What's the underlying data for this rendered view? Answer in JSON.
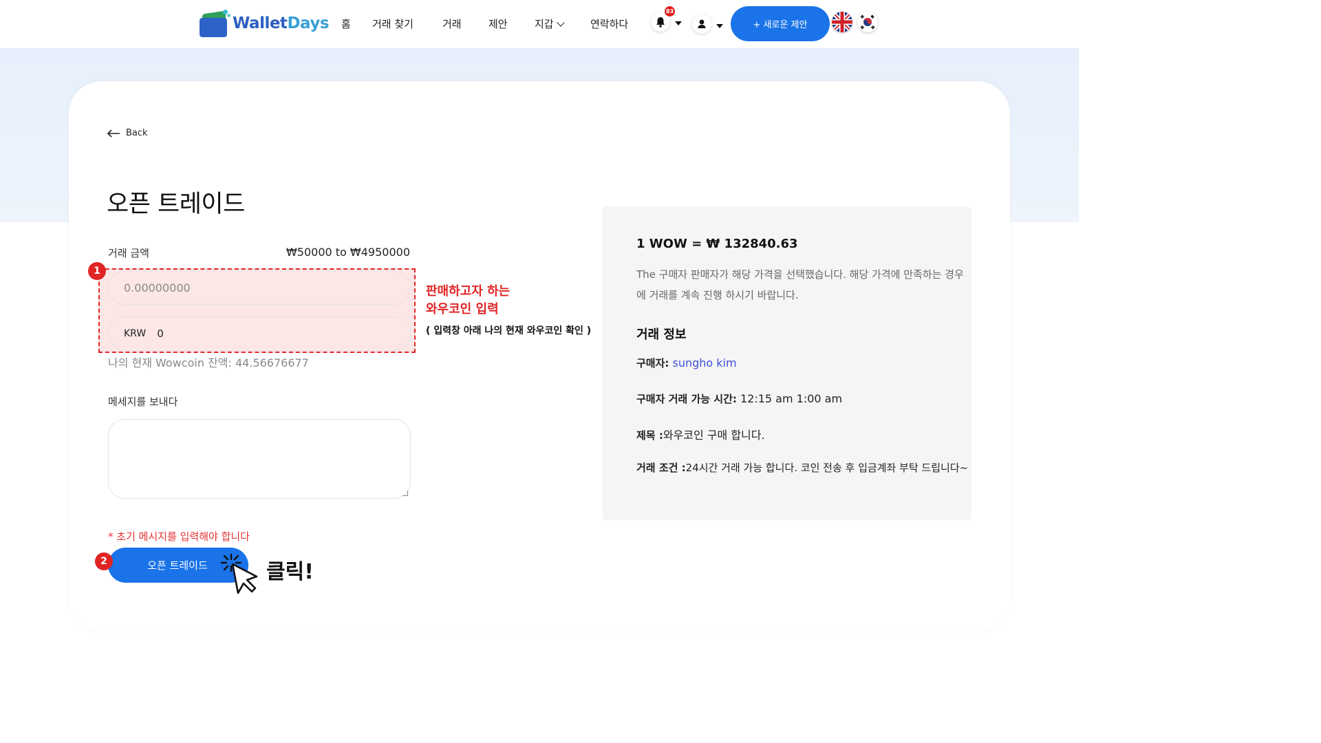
{
  "nav": {
    "logo_part1": "Wallet",
    "logo_part2": "Days",
    "home": "홈",
    "find_trade": "거래 찾기",
    "trade": "거래",
    "offer": "제안",
    "wallet": "지갑",
    "contact": "연락하다",
    "notification_count": "83",
    "new_offer_button": "+ 새로운 제안"
  },
  "page": {
    "back_label": "Back",
    "title": "오픈 트레이드"
  },
  "form": {
    "amount_label": "거래 금액",
    "amount_range": "₩50000 to ₩4950000",
    "wow_placeholder": "0.00000000",
    "krw_prefix": "KRW",
    "krw_value": "0",
    "balance_text": "나의 현재 Wowcoin 잔액: 44.56676677",
    "message_label": "메세지를 보내다",
    "required_note": "* 초기 메시지를 입력해야 합니다",
    "submit_button": "오픈 트레이드"
  },
  "annotations": {
    "step1": "1",
    "step2": "2",
    "step1_line1": "판매하고자 하는",
    "step1_line2": "와우코인 입력",
    "step1_note": "( 입력창 아래 나의 현재 와우코인 확인 )",
    "click_label": "클릭!"
  },
  "info": {
    "rate": "1 WOW = ₩ 132840.63",
    "description": "The 구매자 판매자가 해당 가격을 선택했습니다. 해당 가격에 만족하는 경우에 거래를 계속 진행 하시기 바랍니다.",
    "section_title": "거래 정보",
    "buyer_label": "구매자:",
    "buyer_name": "sungho kim",
    "hours_label": "구매자 거래 가능 시간:",
    "hours_value": "12:15 am 1:00 am",
    "subject_label": "제목 :",
    "subject_value": "와우코인 구매 합니다.",
    "terms_label": "거래 조건 :",
    "terms_value": "24시간 거래 가능 합니다. 코인 전송 후 입금계좌 부탁 드립니다~"
  },
  "colors": {
    "primary": "#1a73e8",
    "annotation_red": "#e02424",
    "buyer_link": "#3d4fd8"
  }
}
